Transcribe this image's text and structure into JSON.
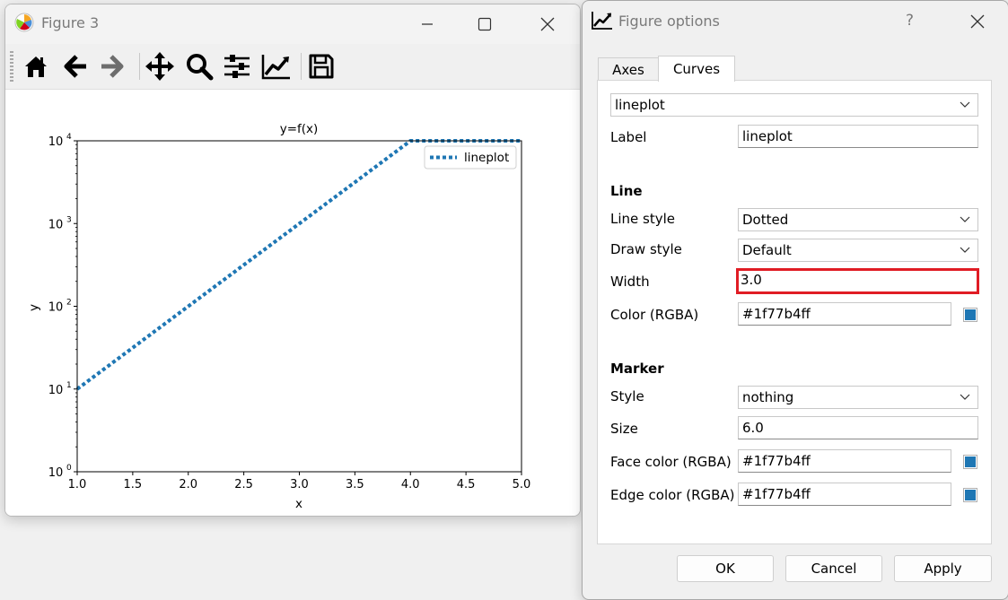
{
  "figure_window": {
    "title": "Figure 3",
    "toolbar": {
      "home_icon": "home-icon",
      "back_icon": "arrow-left-icon",
      "forward_icon": "arrow-right-icon",
      "pan_icon": "move-arrows-icon",
      "zoom_icon": "magnifier-icon",
      "subplots_icon": "sliders-icon",
      "customize_icon": "line-chart-icon",
      "save_icon": "floppy-disk-icon"
    }
  },
  "chart_data": {
    "type": "line",
    "title": "y=f(x)",
    "xlabel": "x",
    "ylabel": "y",
    "yscale": "log",
    "xlim": [
      1.0,
      5.0
    ],
    "ylim": [
      1,
      10000
    ],
    "x_ticks": [
      "1.0",
      "1.5",
      "2.0",
      "2.5",
      "3.0",
      "3.5",
      "4.0",
      "4.5",
      "5.0"
    ],
    "y_ticks": [
      {
        "base": "10",
        "exp": "0"
      },
      {
        "base": "10",
        "exp": "1"
      },
      {
        "base": "10",
        "exp": "2"
      },
      {
        "base": "10",
        "exp": "3"
      },
      {
        "base": "10",
        "exp": "4"
      }
    ],
    "legend": "top-right",
    "grid": false,
    "series": [
      {
        "name": "lineplot",
        "color": "#1f77b4",
        "linestyle": "dotted",
        "linewidth": 3.0,
        "x": [
          1.0,
          1.5,
          2.0,
          2.5,
          3.0,
          3.5,
          4.0,
          4.5,
          5.0
        ],
        "y": [
          10,
          31.6,
          100,
          316,
          1000,
          3160,
          10000,
          10000,
          10000
        ]
      }
    ]
  },
  "dialog": {
    "title": "Figure options",
    "help": "?",
    "tabs": [
      "Axes",
      "Curves"
    ],
    "active_tab": "Curves",
    "curve_select": "lineplot",
    "label_text": "Label",
    "label_value": "lineplot",
    "line_header": "Line",
    "line_style_label": "Line style",
    "line_style_value": "Dotted",
    "draw_style_label": "Draw style",
    "draw_style_value": "Default",
    "width_label": "Width",
    "width_value": "3.0",
    "color_label": "Color (RGBA)",
    "color_value": "#1f77b4ff",
    "marker_header": "Marker",
    "marker_style_label": "Style",
    "marker_style_value": "nothing",
    "size_label": "Size",
    "size_value": "6.0",
    "face_color_label": "Face color (RGBA)",
    "face_color_value": "#1f77b4ff",
    "edge_color_label": "Edge color (RGBA)",
    "edge_color_value": "#1f77b4ff",
    "ok": "OK",
    "cancel": "Cancel",
    "apply": "Apply",
    "swatch_color": "#1f77b4",
    "highlight_color": "#e01c24"
  }
}
